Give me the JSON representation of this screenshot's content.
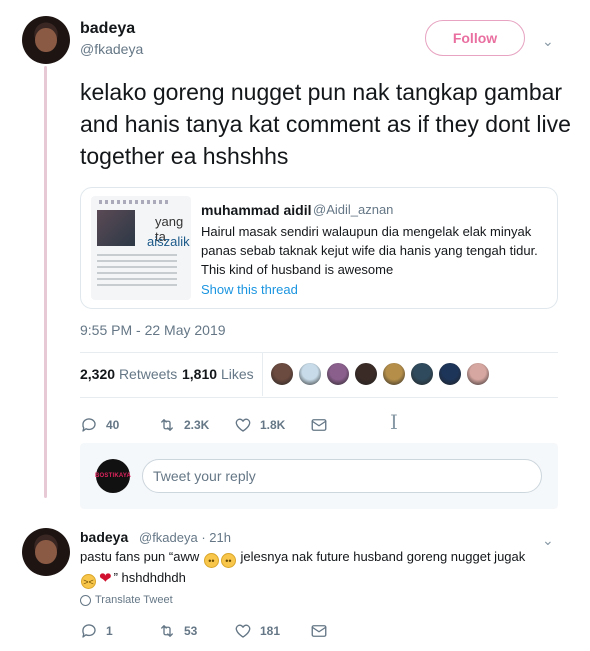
{
  "main_tweet": {
    "author_name": "badeya",
    "author_handle": "@fkadeya",
    "follow_label": "Follow",
    "text": "kelako goreng nugget pun nak tangkap gambar and hanis tanya kat comment as if they dont live together ea hshshhs",
    "timestamp": "9:55 PM - 22 May 2019",
    "retweets_count": "2,320",
    "retweets_label": "Retweets",
    "likes_count": "1,810",
    "likes_label": "Likes",
    "actions": {
      "replies": "40",
      "retweets": "2.3K",
      "likes": "1.8K"
    }
  },
  "quoted_tweet": {
    "author_name": "muhammad aidil",
    "author_handle": "@Aidil_aznan",
    "text": "Hairul masak sendiri walaupun dia  mengelak elak minyak panas sebab taknak kejut wife dia hanis yang tengah tidur. This kind of husband is awesome",
    "show_thread": "Show this thread",
    "thumb_text_1": "yang ta",
    "thumb_text_2": "aiszalik"
  },
  "reply_box": {
    "placeholder": "Tweet your reply",
    "avatar_text": "BOSTIKAYA"
  },
  "reply_tweet": {
    "author_name": "badeya",
    "meta": "@fkadeya · 21h",
    "text_part1": "pastu fans pun “aww",
    "text_part2": "jelesnya nak future husband goreng nugget jugak",
    "text_part3": "”  hshdhdhdh",
    "translate": "Translate Tweet",
    "actions": {
      "replies": "1",
      "retweets": "53",
      "likes": "181"
    }
  },
  "liker_colors": [
    "#6b4a3f",
    "#c7dbe8",
    "#8a5f8c",
    "#3a2b26",
    "#b58f4a",
    "#2f4a5c",
    "#1d3559",
    "#d6a6a0"
  ],
  "colors": {
    "accent_pink": "#e0245e",
    "link_blue": "#1b95e0",
    "muted": "#657786"
  },
  "icons": {
    "reply": "reply-icon",
    "retweet": "retweet-icon",
    "like": "heart-icon",
    "dm": "envelope-icon",
    "caret": "chevron-down-icon",
    "translate": "globe-icon"
  }
}
